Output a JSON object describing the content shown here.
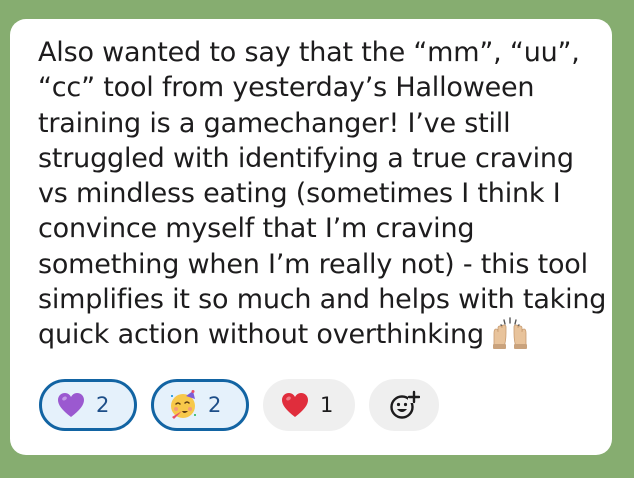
{
  "message": {
    "lines": [
      "Also wanted to say that the “mm”, “uu”,",
      "“cc” tool from yesterday’s Halloween",
      "training is a gamechanger! I’ve still",
      "struggled with identifying a true craving",
      "vs mindless eating (sometimes I think I",
      "convince myself that I’m craving",
      "something when I’m really not) - this tool",
      "simplifies it so much and helps with taking",
      "quick action without overthinking"
    ],
    "trailing_emoji": "raising-hands-emoji"
  },
  "reactions": [
    {
      "emoji": "purple-heart-emoji",
      "count": "2",
      "selected": true
    },
    {
      "emoji": "partying-face-emoji",
      "count": "2",
      "selected": true
    },
    {
      "emoji": "red-heart-emoji",
      "count": "1",
      "selected": false
    }
  ],
  "add_reaction": {
    "icon": "add-reaction-icon"
  },
  "colors": {
    "background": "#86ad70",
    "card": "#ffffff",
    "text": "#1d1c1d",
    "selected_border": "#1264a3",
    "selected_fill": "#e5f1fb",
    "pill_fill": "#efefef"
  }
}
